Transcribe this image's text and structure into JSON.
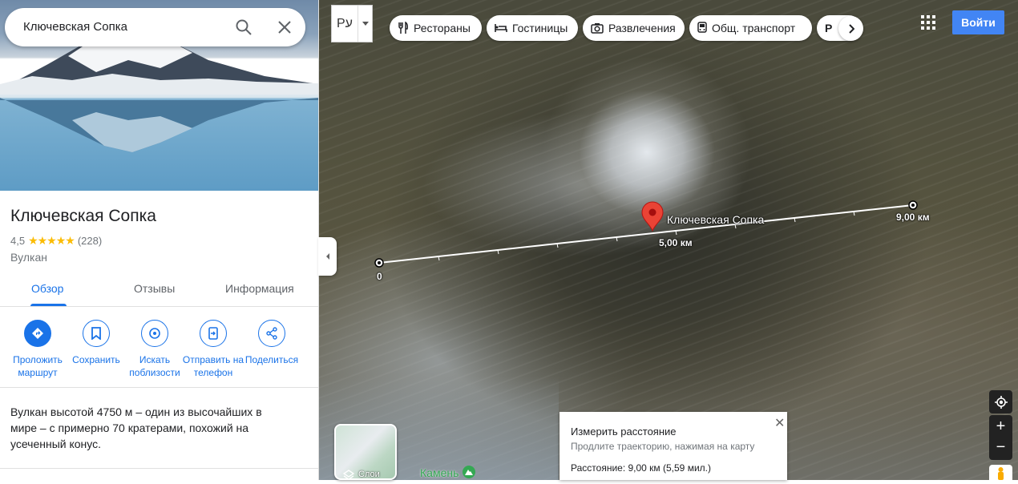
{
  "search": {
    "query": "Ключевская Сопка"
  },
  "place": {
    "title": "Ключевская Сопка",
    "rating": "4,5",
    "stars": "★★★★★",
    "reviews": "(228)",
    "category": "Вулкан",
    "description": "Вулкан высотой 4750 м – один из высочайших в мире – с примерно 70 кратерами, похожий на усеченный конус."
  },
  "tabs": [
    {
      "label": "Обзор",
      "active": true
    },
    {
      "label": "Отзывы",
      "active": false
    },
    {
      "label": "Информация",
      "active": false
    }
  ],
  "actions": [
    {
      "label": "Проложить маршрут",
      "icon": "directions-icon"
    },
    {
      "label": "Сохранить",
      "icon": "bookmark-icon"
    },
    {
      "label": "Искать поблизости",
      "icon": "nearby-icon"
    },
    {
      "label": "Отправить на телефон",
      "icon": "send-to-phone-icon"
    },
    {
      "label": "Поделиться",
      "icon": "share-icon"
    }
  ],
  "map": {
    "language_button": "Рע",
    "chips": [
      "Рестораны",
      "Гостиницы",
      "Развлечения",
      "Общ. транспорт",
      "Р"
    ],
    "signin": "Войти",
    "marker_label": "Ключевская Сопка",
    "scale": [
      "0",
      "5,00 км",
      "9,00 км"
    ],
    "layers_label": "Слои",
    "poi_label": "Камень"
  },
  "measure": {
    "title": "Измерить расстояние",
    "hint": "Продлите траекторию, нажимая на карту",
    "distance": "Расстояние: 9,00 км (5,59 мил.)"
  },
  "colors": {
    "accent": "#1a73e8",
    "signin": "#4285f4",
    "marker": "#ea4335",
    "star": "#fbbc04"
  }
}
